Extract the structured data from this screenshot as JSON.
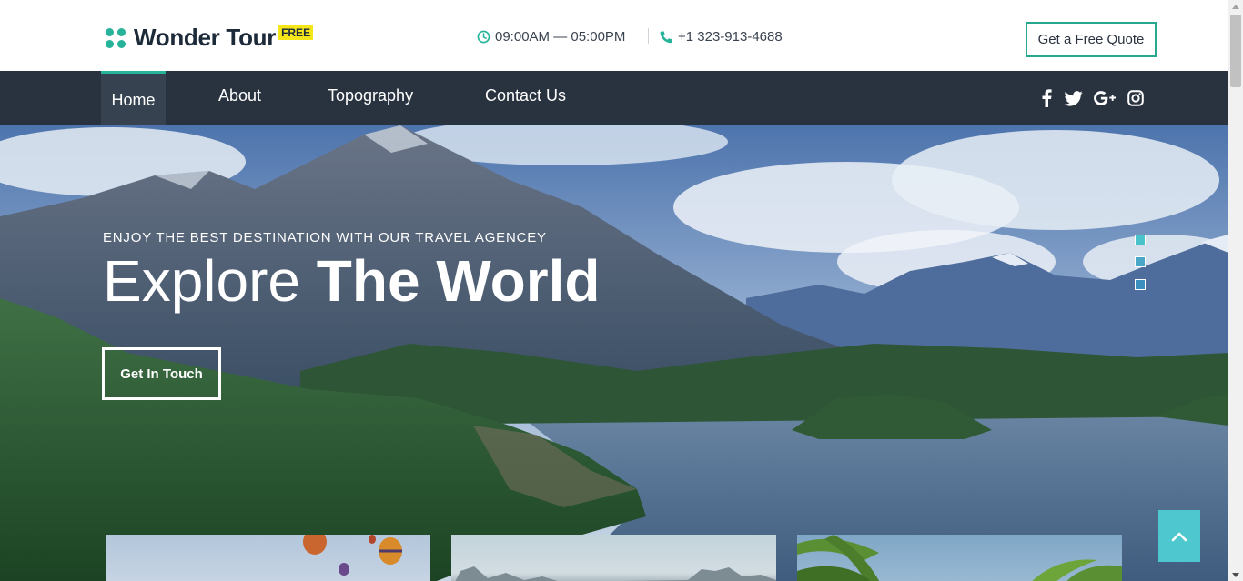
{
  "brand": {
    "name": "Wonder Tour",
    "badge": "FREE",
    "accent_color": "#26b39a",
    "dark_color": "#29333f"
  },
  "header": {
    "hours": "09:00AM — 05:00PM",
    "hours_icon": "clock-icon",
    "phone": "+1 323-913-4688",
    "phone_icon": "phone-icon",
    "quote_button": "Get a Free Quote"
  },
  "nav": {
    "items": [
      {
        "label": "Home",
        "active": true
      },
      {
        "label": "About",
        "active": false
      },
      {
        "label": "Topography",
        "active": false
      },
      {
        "label": "Contact Us",
        "active": false
      }
    ],
    "social": [
      "facebook-icon",
      "twitter-icon",
      "google-plus-icon",
      "instagram-icon"
    ]
  },
  "hero": {
    "tagline": "ENJOY THE BEST DESTINATION WITH OUR TRAVEL AGENCEY",
    "headline_light": "Explore ",
    "headline_bold": "The World",
    "cta": "Get In Touch",
    "slide_count": 3,
    "active_slide": 1
  },
  "scroll_top": {
    "icon": "chevron-up-icon",
    "color": "#4fc7cf"
  }
}
